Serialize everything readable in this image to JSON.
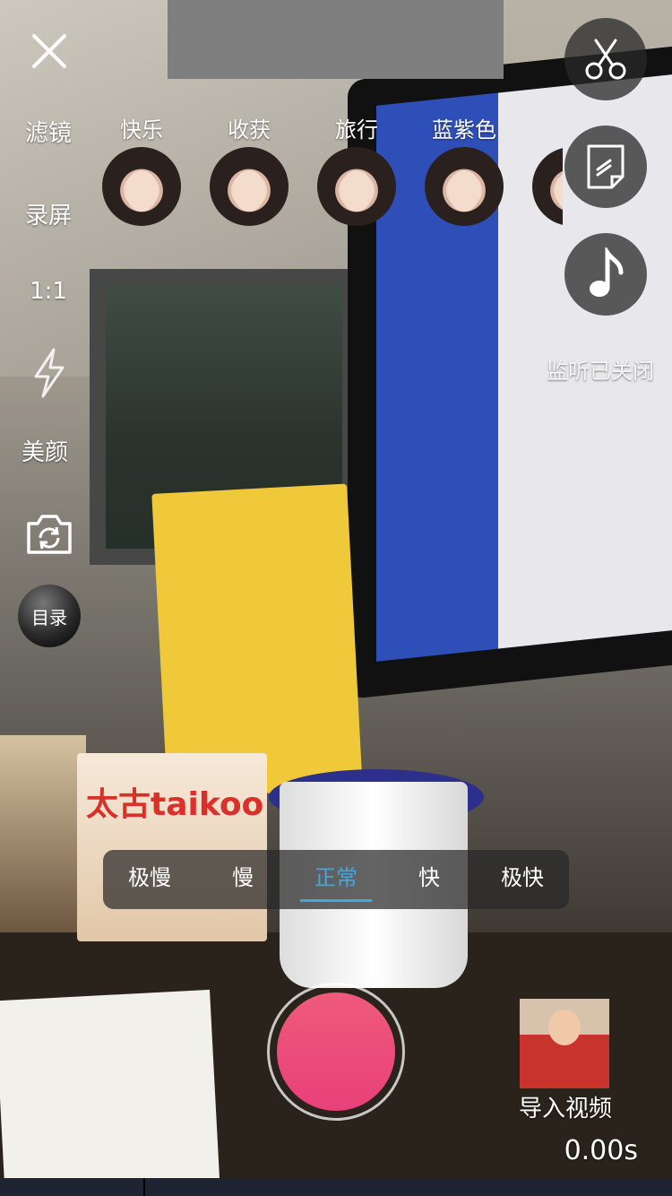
{
  "top_left": {
    "close_icon": "close-icon"
  },
  "side_menu": {
    "filter_label": "滤镜",
    "record_screen_label": "录屏",
    "aspect_ratio_label": "1:1",
    "flash_icon": "lightning-icon",
    "beauty_label": "美颜",
    "switch_camera_icon": "camera-switch-icon",
    "catalog_label": "目录"
  },
  "filters": [
    {
      "name": "快乐"
    },
    {
      "name": "收获"
    },
    {
      "name": "旅行"
    },
    {
      "name": "蓝紫色"
    }
  ],
  "right_tools": {
    "cut_icon": "scissors-icon",
    "note_icon": "note-icon",
    "music_icon": "music-note-icon",
    "monitor_status": "监听已关闭"
  },
  "speed": {
    "options": [
      "极慢",
      "慢",
      "正常",
      "快",
      "极快"
    ],
    "selected": "正常",
    "accent_color": "#3fa8e0"
  },
  "record": {
    "button_color": "#e9407a"
  },
  "import": {
    "label": "导入视频"
  },
  "timer": "0.00s"
}
